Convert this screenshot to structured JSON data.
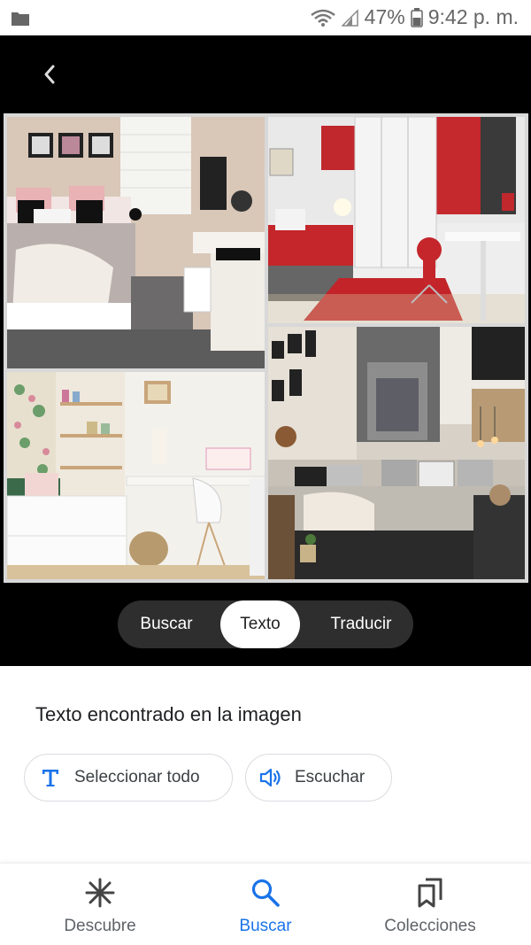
{
  "status_bar": {
    "battery": "47%",
    "time": "9:42 p. m.",
    "icons": [
      "folder-icon",
      "wifi-icon",
      "signal-icon",
      "battery-icon"
    ]
  },
  "image_view": {
    "back_icon": "chevron-left-icon",
    "tiles": [
      "bedroom-photo-1",
      "bedroom-photo-2",
      "bedroom-photo-3",
      "bedroom-photo-4"
    ]
  },
  "mode_tabs": {
    "items": [
      "Buscar",
      "Texto",
      "Traducir"
    ],
    "selected": "Texto"
  },
  "results": {
    "title": "Texto encontrado en la imagen",
    "select_all_label": "Seleccionar todo",
    "listen_label": "Escuchar"
  },
  "bottom_nav": {
    "items": [
      {
        "label": "Descubre",
        "icon": "asterisk-icon"
      },
      {
        "label": "Buscar",
        "icon": "search-icon"
      },
      {
        "label": "Colecciones",
        "icon": "bookmarks-icon"
      }
    ],
    "active": "Buscar"
  },
  "colors": {
    "accent": "#1a73e8",
    "dark_bg": "#000000",
    "segment_bg": "#2e2e2e"
  }
}
